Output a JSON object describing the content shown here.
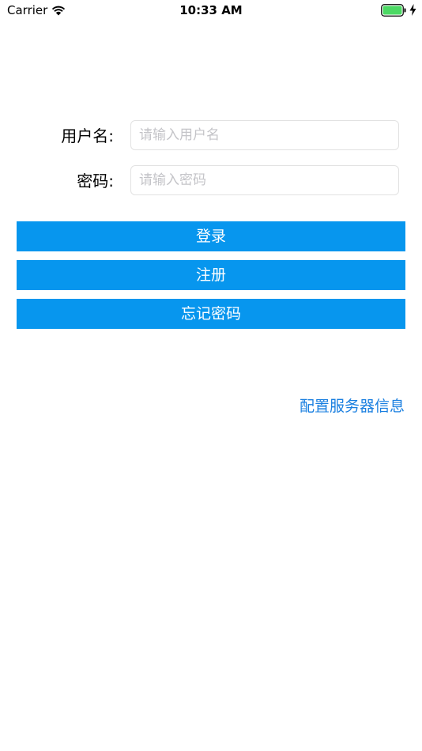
{
  "status_bar": {
    "carrier": "Carrier",
    "time": "10:33 AM",
    "icons": [
      "wifi-icon",
      "battery-icon",
      "charging-bolt-icon"
    ],
    "battery_color": "#4cd964"
  },
  "form": {
    "username": {
      "label": "用户名:",
      "value": "",
      "placeholder": "请输入用户名"
    },
    "password": {
      "label": "密码:",
      "value": "",
      "placeholder": "请输入密码"
    }
  },
  "buttons": {
    "login": "登录",
    "register": "注册",
    "forgot_password": "忘记密码"
  },
  "config_link": "配置服务器信息",
  "colors": {
    "button_bg": "#0796ee",
    "link": "#1a7fe0",
    "input_border": "#e2e2e2",
    "placeholder": "#c4c4c8"
  }
}
